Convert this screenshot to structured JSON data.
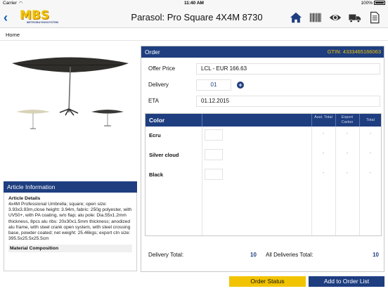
{
  "status_bar": {
    "carrier": "Carrier",
    "time": "11:40 AM",
    "battery": "100%"
  },
  "nav": {
    "title": "Parasol: Pro Square 4X4M 8730",
    "logo_text": "MBS",
    "logo_subtext": "METROBUYINGSYSTEM",
    "icons": [
      "home-icon",
      "barcode-icon",
      "eye-icon",
      "truck-icon",
      "document-icon"
    ]
  },
  "breadcrumb": "Home",
  "article": {
    "heading": "Article Information",
    "details_title": "Article Details",
    "details_text": "4x4M Professional Umbrella; square; open size: 3.93x3.93m,close height: 3.94m, fabric: 250g polyester, with UV50+, with PA coating, w/o flap; alu pole: Dia.55x1.2mm thickness, 8pcs alu ribs: 20x30x1.5mm thickness; anodized alu frame, with steel crank open system, with steel crossing base, powder coated; net weight: 25.46kgs; export ctn size: 395.5x25.5x25.5cm",
    "material_title": "Material Composition"
  },
  "order": {
    "heading": "Order",
    "gtin": "GTIN: 4333465166063",
    "offer_price_label": "Offer Price",
    "offer_price_value": "LCL - EUR 166.63",
    "delivery_label": "Delivery",
    "delivery_value": "01",
    "eta_label": "ETA",
    "eta_value": "01.12.2015",
    "table": {
      "color_header": "Color",
      "asst_total_header": "Asst. Total",
      "export_carton_header": "Export Carton",
      "total_header": "Total",
      "rows": [
        {
          "name": "Ecru",
          "asst": "-",
          "export": "-",
          "total": "-"
        },
        {
          "name": "Silver cloud",
          "asst": "-",
          "export": "-",
          "total": "-"
        },
        {
          "name": "Black",
          "asst": "-",
          "export": "-",
          "total": "-"
        }
      ]
    },
    "delivery_total_label": "Delivery Total:",
    "delivery_total_value": "10",
    "all_deliveries_label": "All Deliveries Total:",
    "all_deliveries_value": "10"
  },
  "buttons": {
    "order_status": "Order Status",
    "add_to_order_list": "Add to Order List"
  },
  "colors": {
    "primary": "#1e3e80",
    "accent": "#f2c300",
    "link": "#0a5db5"
  }
}
